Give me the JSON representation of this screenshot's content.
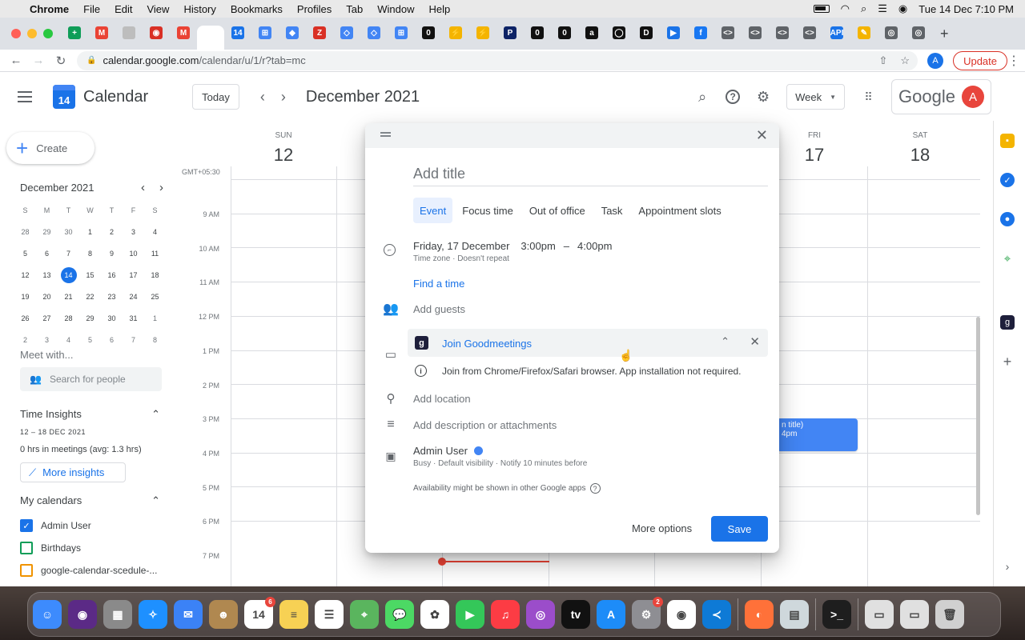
{
  "menubar": {
    "apple": "",
    "items": [
      "Chrome",
      "File",
      "Edit",
      "View",
      "History",
      "Bookmarks",
      "Profiles",
      "Tab",
      "Window",
      "Help"
    ],
    "clock": "Tue 14 Dec  7:10 PM"
  },
  "tabs": [
    {
      "glyph": "+",
      "color": "#0f9d58"
    },
    {
      "glyph": "M",
      "color": "#ea4335"
    },
    {
      "glyph": "",
      "color": "#bdbdbd"
    },
    {
      "glyph": "◉",
      "color": "#d93025"
    },
    {
      "glyph": "M",
      "color": "#ea4335"
    },
    {
      "glyph": "",
      "color": "#ffffff",
      "active": true
    },
    {
      "glyph": "14",
      "color": "#1a73e8"
    },
    {
      "glyph": "⊞",
      "color": "#4285f4"
    },
    {
      "glyph": "◆",
      "color": "#4285f4"
    },
    {
      "glyph": "Z",
      "color": "#d93025"
    },
    {
      "glyph": "◇",
      "color": "#4285f4"
    },
    {
      "glyph": "◇",
      "color": "#4285f4"
    },
    {
      "glyph": "⊞",
      "color": "#4285f4"
    },
    {
      "glyph": "0",
      "color": "#111111"
    },
    {
      "glyph": "⚡",
      "color": "#f4b400"
    },
    {
      "glyph": "⚡",
      "color": "#f4b400"
    },
    {
      "glyph": "P",
      "color": "#0d2366"
    },
    {
      "glyph": "0",
      "color": "#111111"
    },
    {
      "glyph": "0",
      "color": "#111111"
    },
    {
      "glyph": "a",
      "color": "#111111"
    },
    {
      "glyph": "◯",
      "color": "#111111"
    },
    {
      "glyph": "D",
      "color": "#111111"
    },
    {
      "glyph": "▶",
      "color": "#1a73e8"
    },
    {
      "glyph": "f",
      "color": "#1877f2"
    },
    {
      "glyph": "<>",
      "color": "#5f6368"
    },
    {
      "glyph": "<>",
      "color": "#5f6368"
    },
    {
      "glyph": "<>",
      "color": "#5f6368"
    },
    {
      "glyph": "<>",
      "color": "#5f6368"
    },
    {
      "glyph": "API",
      "color": "#1a73e8"
    },
    {
      "glyph": "✎",
      "color": "#f4b400"
    },
    {
      "glyph": "◎",
      "color": "#5f6368"
    },
    {
      "glyph": "◎",
      "color": "#5f6368"
    }
  ],
  "newtab": "+",
  "address": {
    "host": "calendar.google.com",
    "path": "/calendar/u/1/r?tab=mc",
    "update_label": "Update",
    "profile_initial": "A"
  },
  "header": {
    "app_name": "Calendar",
    "logo_day": "14",
    "today_label": "Today",
    "prev": "‹",
    "next": "›",
    "date_title": "December 2021",
    "view_label": "Week",
    "google_word": "Google",
    "account_initial": "A"
  },
  "sidebar": {
    "create_label": "Create",
    "mini_title": "December 2021",
    "weekday_letters": [
      "S",
      "M",
      "T",
      "W",
      "T",
      "F",
      "S"
    ],
    "mini_days": [
      "28",
      "29",
      "30",
      "1",
      "2",
      "3",
      "4",
      "5",
      "6",
      "7",
      "8",
      "9",
      "10",
      "11",
      "12",
      "13",
      "14",
      "15",
      "16",
      "17",
      "18",
      "19",
      "20",
      "21",
      "22",
      "23",
      "24",
      "25",
      "26",
      "27",
      "28",
      "29",
      "30",
      "31",
      "1",
      "2",
      "3",
      "4",
      "5",
      "6",
      "7",
      "8"
    ],
    "meet_label": "Meet with...",
    "search_placeholder": "Search for people",
    "time_insights_title": "Time Insights",
    "insights_range": "12 – 18 DEC 2021",
    "insights_hours": "0 hrs in meetings (avg: 1.3 hrs)",
    "more_insights": "More insights",
    "my_calendars_title": "My calendars",
    "calendars": [
      {
        "name": "Admin User",
        "color": "#1a73e8",
        "checked": true
      },
      {
        "name": "Birthdays",
        "color": "#0f9d58",
        "checked": false
      },
      {
        "name": "google-calendar-scedule-...",
        "color": "#f09300",
        "checked": false
      }
    ]
  },
  "grid": {
    "gmt": "GMT+05:30",
    "days": [
      {
        "name": "SUN",
        "num": "12"
      },
      {
        "name": "FRI",
        "num": "17"
      },
      {
        "name": "SAT",
        "num": "18"
      }
    ],
    "hours": [
      "9 AM",
      "10 AM",
      "11 AM",
      "12 PM",
      "1 PM",
      "2 PM",
      "3 PM",
      "4 PM",
      "5 PM",
      "6 PM",
      "7 PM"
    ],
    "event_line1": "n title)",
    "event_line2": "4pm"
  },
  "dialog": {
    "title_placeholder": "Add title",
    "type_tabs": [
      "Event",
      "Focus time",
      "Out of office",
      "Task",
      "Appointment slots"
    ],
    "date": "Friday, 17 December",
    "start": "3:00pm",
    "dash": "–",
    "end": "4:00pm",
    "date_sub": "Time zone · Doesn't repeat",
    "find_time": "Find a time",
    "add_guests": "Add guests",
    "goodmeetings_label": "Join Goodmeetings",
    "goodmeetings_note": "Join from Chrome/Firefox/Safari browser. App installation not required.",
    "add_location": "Add location",
    "add_description": "Add description or attachments",
    "owner": "Admin User",
    "owner_sub": "Busy · Default visibility · Notify 10 minutes before",
    "availability_note": "Availability might be shown in other Google apps",
    "more_options": "More options",
    "save": "Save"
  },
  "dock": [
    {
      "name": "finder",
      "color": "#3d8bfd",
      "glyph": "☺"
    },
    {
      "name": "siri",
      "color": "#5b2a86",
      "glyph": "◉"
    },
    {
      "name": "launchpad",
      "color": "#8a8a8a",
      "glyph": "▦"
    },
    {
      "name": "safari",
      "color": "#1e90ff",
      "glyph": "✧"
    },
    {
      "name": "mail",
      "color": "#3b82f6",
      "glyph": "✉"
    },
    {
      "name": "contacts",
      "color": "#b08850",
      "glyph": "☻"
    },
    {
      "name": "calendar",
      "color": "#ffffff",
      "glyph": "14",
      "badge": "6"
    },
    {
      "name": "notes",
      "color": "#f7d154",
      "glyph": "≡"
    },
    {
      "name": "reminders",
      "color": "#ffffff",
      "glyph": "☰"
    },
    {
      "name": "maps",
      "color": "#5ab55e",
      "glyph": "⌖"
    },
    {
      "name": "messages",
      "color": "#4cd964",
      "glyph": "💬"
    },
    {
      "name": "photos",
      "color": "#ffffff",
      "glyph": "✿"
    },
    {
      "name": "facetime",
      "color": "#34c759",
      "glyph": "▶"
    },
    {
      "name": "music",
      "color": "#fc3c44",
      "glyph": "♫"
    },
    {
      "name": "podcasts",
      "color": "#9b4dca",
      "glyph": "◎"
    },
    {
      "name": "tv",
      "color": "#111111",
      "glyph": "tv"
    },
    {
      "name": "appstore",
      "color": "#1d8cf8",
      "glyph": "A"
    },
    {
      "name": "settings",
      "color": "#8e8e93",
      "glyph": "⚙",
      "badge": "2"
    },
    {
      "name": "chrome",
      "color": "#ffffff",
      "glyph": "◉"
    },
    {
      "name": "vscode",
      "color": "#0e7ad6",
      "glyph": "≺"
    },
    {
      "name": "firefox",
      "color": "#ff7139",
      "glyph": "◐"
    },
    {
      "name": "preview",
      "color": "#cfd8dc",
      "glyph": "▤"
    },
    {
      "name": "terminal",
      "color": "#1e1e1e",
      "glyph": ">_"
    },
    {
      "name": "window",
      "color": "#e0e0e0",
      "glyph": "▭"
    },
    {
      "name": "window2",
      "color": "#e0e0e0",
      "glyph": "▭"
    },
    {
      "name": "trash",
      "color": "#d0d0d0",
      "glyph": "🗑"
    }
  ]
}
